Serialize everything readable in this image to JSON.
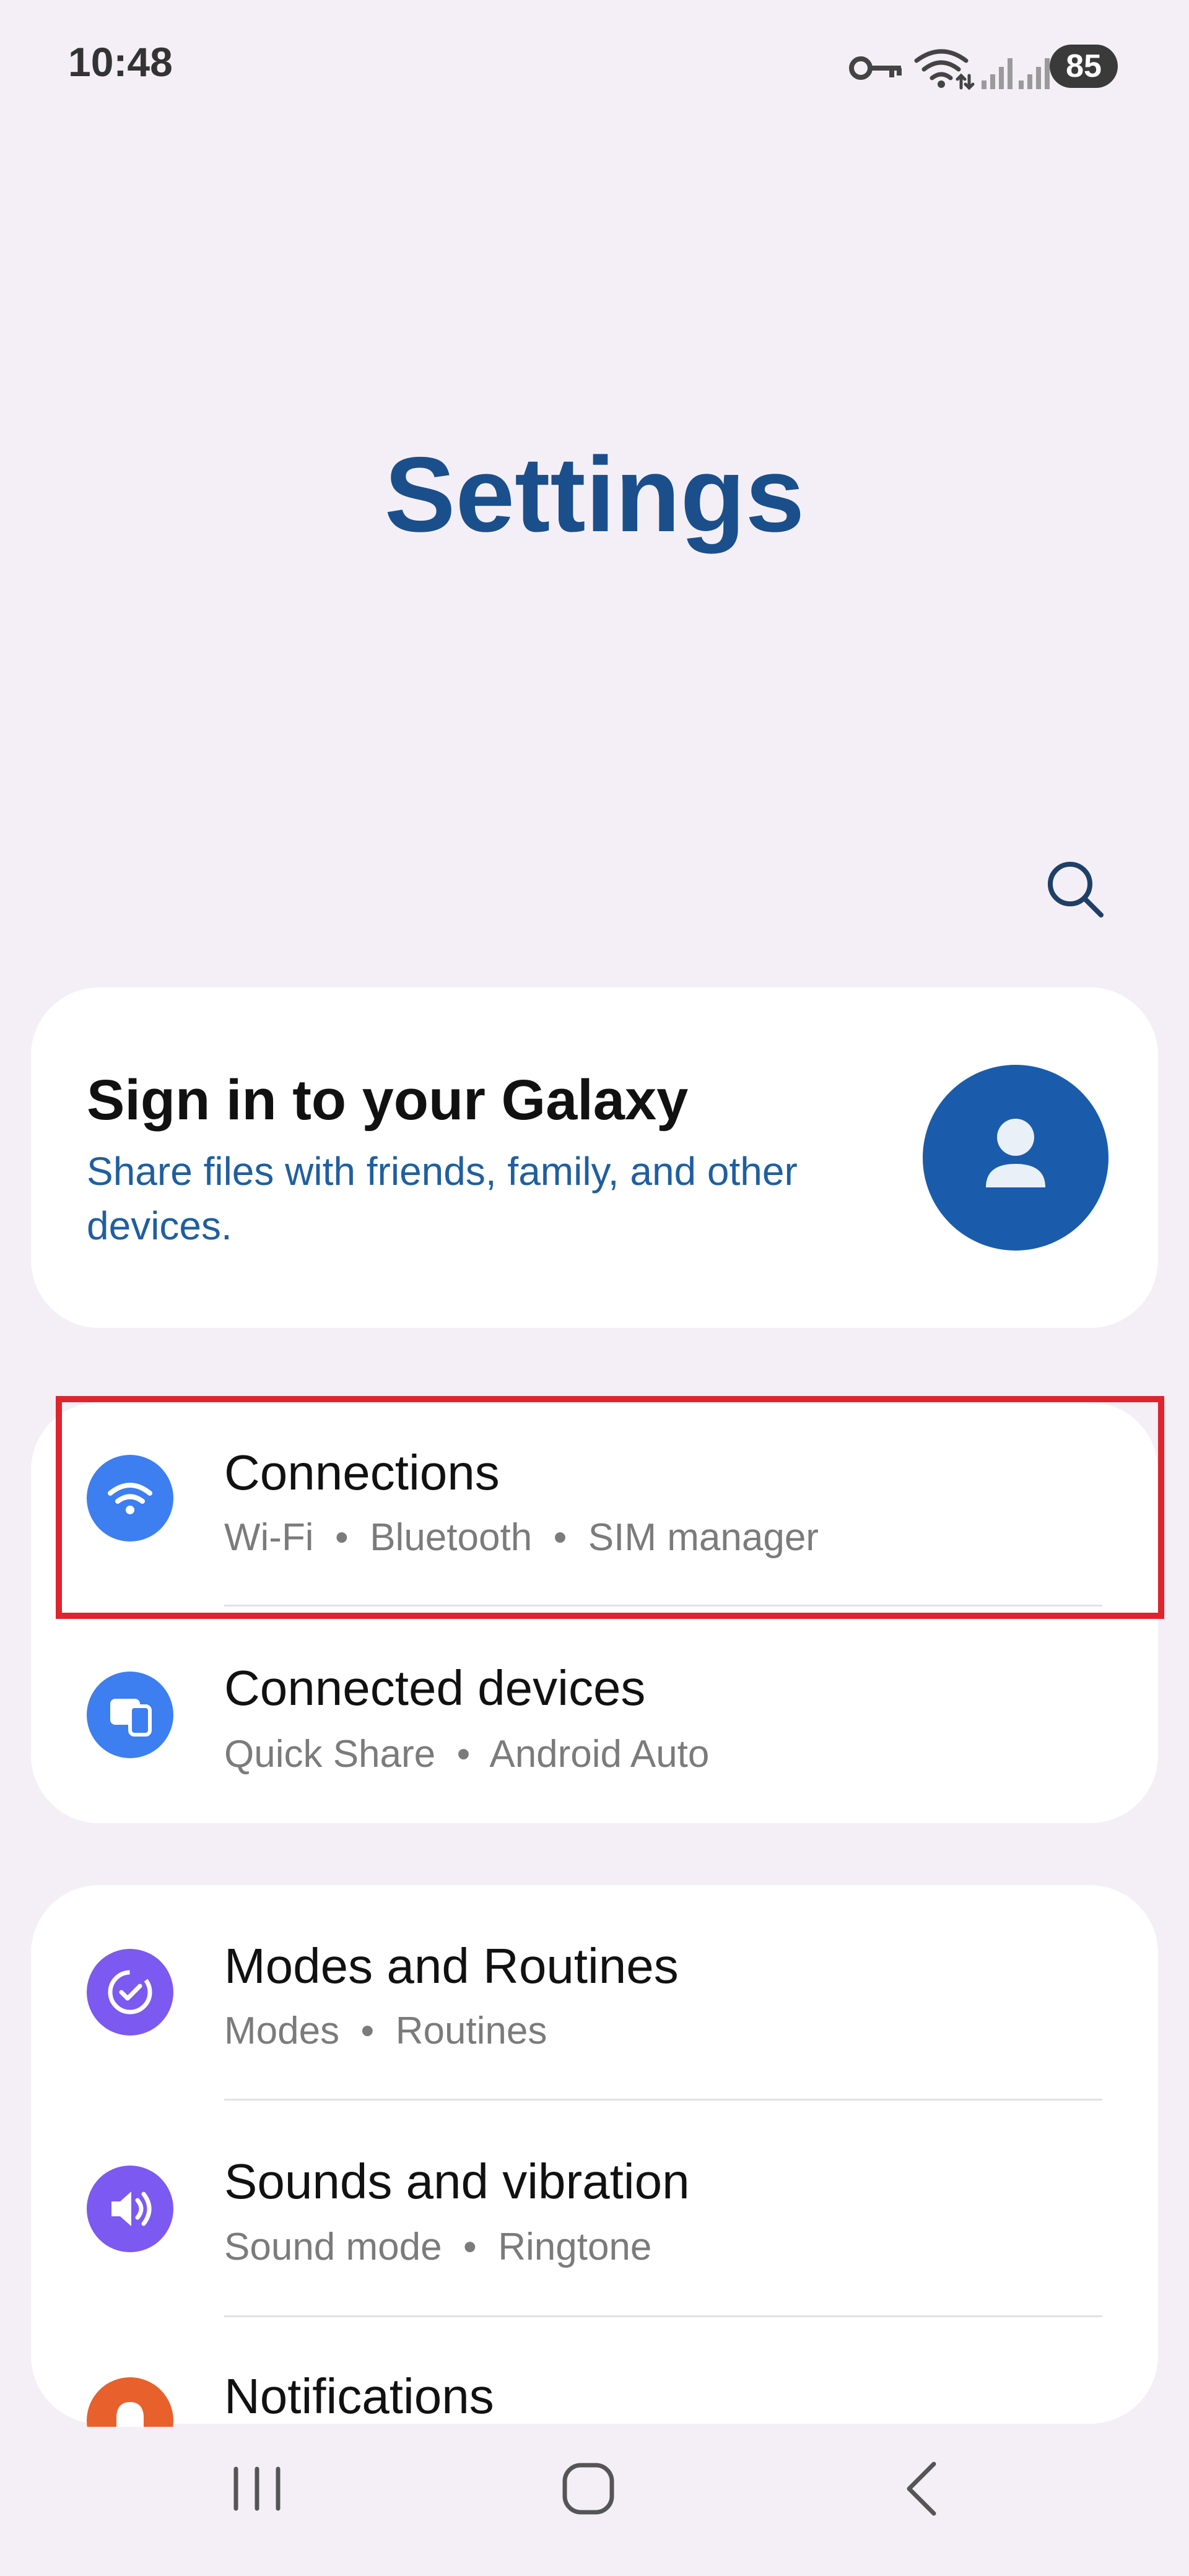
{
  "status_bar": {
    "time": "10:48",
    "battery": "85",
    "icons": [
      "vpn-key-icon",
      "wifi-icon",
      "signal-icon",
      "signal-icon"
    ]
  },
  "header": {
    "title": "Settings",
    "search_icon": "search-icon"
  },
  "account_card": {
    "title": "Sign in to your Galaxy",
    "subtitle_line1": "Share files with friends, family, and other",
    "subtitle_line2": "devices.",
    "avatar_icon": "person-icon"
  },
  "settings_groups": [
    {
      "items": [
        {
          "title": "Connections",
          "subtitle": "Wi-Fi  •  Bluetooth  •  SIM manager",
          "icon": "wifi-icon",
          "icon_color": "#3d7ff0",
          "highlighted": true
        },
        {
          "title": "Connected devices",
          "subtitle": "Quick Share  •  Android Auto",
          "icon": "devices-icon",
          "icon_color": "#3d7ff0"
        }
      ]
    },
    {
      "items": [
        {
          "title": "Modes and Routines",
          "subtitle": "Modes  •  Routines",
          "icon": "modes-routines-icon",
          "icon_color": "#7c59f0"
        },
        {
          "title": "Sounds and vibration",
          "subtitle": "Sound mode  •  Ringtone",
          "icon": "volume-icon",
          "icon_color": "#7c59f0"
        },
        {
          "title": "Notifications",
          "subtitle": "",
          "icon": "notifications-icon",
          "icon_color": "#e8612c"
        }
      ]
    }
  ],
  "colors": {
    "background": "#f4eff6",
    "title": "#1a4f8b",
    "highlight_box": "#e1232d",
    "avatar": "#1a5cab"
  },
  "nav_bar": {
    "recent": "recent-apps-icon",
    "home": "home-icon",
    "back": "back-icon"
  }
}
